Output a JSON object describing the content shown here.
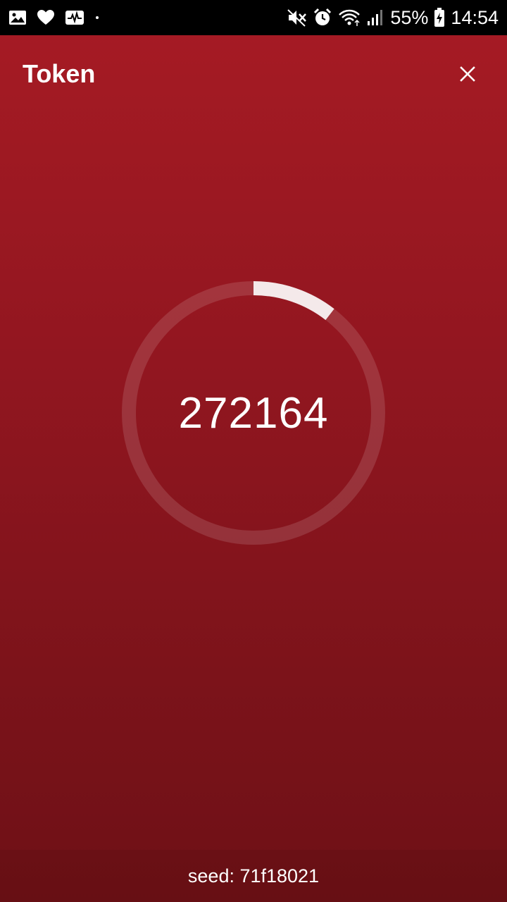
{
  "status_bar": {
    "battery": "55%",
    "time": "14:54",
    "icons": [
      "gallery-icon",
      "heart-icon",
      "activity-icon",
      "dot-icon",
      "mute-icon",
      "alarm-icon",
      "wifi-icon",
      "signal-icon",
      "battery-icon"
    ]
  },
  "header": {
    "title": "Token",
    "close_icon": "close-icon"
  },
  "token": {
    "code": "272164",
    "progress_fraction": 0.105
  },
  "footer": {
    "seed_text": "seed: 71f18021"
  },
  "colors": {
    "background_top": "#a71b24",
    "background_bottom": "#6e1016",
    "ring_track": "rgba(255,255,255,0.13)",
    "ring_progress": "#f4e9ea",
    "status_bar": "#000000"
  }
}
